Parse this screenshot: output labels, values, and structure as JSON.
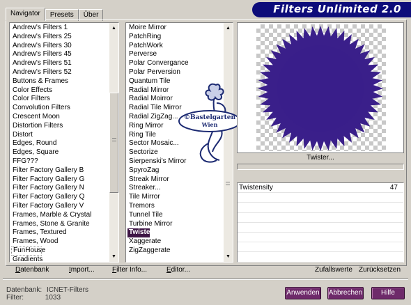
{
  "tabs": [
    {
      "label": "Navigator",
      "active": true
    },
    {
      "label": "Presets"
    },
    {
      "label": "Über"
    }
  ],
  "banner": {
    "title": "Filters Unlimited 2.0"
  },
  "categories": {
    "items": [
      "Andrew's Filters 1",
      "Andrew's Filters 25",
      "Andrew's Filters 30",
      "Andrew's Filters 45",
      "Andrew's Filters 51",
      "Andrew's Filters 52",
      "Buttons & Frames",
      "Color Effects",
      "Color Filters",
      "Convolution Filters",
      "Crescent Moon",
      "Distortion Filters",
      "Distort",
      "Edges, Round",
      "Edges, Square",
      "FFG???",
      "Filter Factory Gallery B",
      "Filter Factory Gallery G",
      "Filter Factory Gallery N",
      "Filter Factory Gallery Q",
      "Filter Factory Gallery V",
      "Frames, Marble & Crystal",
      "Frames, Stone & Granite",
      "Frames, Textured",
      "Frames, Wood",
      "FunHouse",
      "Gradients"
    ],
    "current": "FunHouse"
  },
  "filters": {
    "items": [
      "Moire Mirror",
      "PatchRing",
      "PatchWork",
      "Perverse",
      "Polar Convergance",
      "Polar Perversion",
      "Quantum Tile",
      "Radial Mirror",
      "Radial Moirror",
      "Radial Tile Mirror",
      "Radial ZigZag...",
      "Ring Mirror",
      "Ring Tile",
      "Sector Mosaic...",
      "Sectorize",
      "Sierpenski's Mirror",
      "SpyroZag",
      "Streak Mirror",
      "Streaker...",
      "Tile Mirror",
      "Tremors",
      "Tunnel Tile",
      "Turbine Mirror",
      "Twister",
      "Xaggerate",
      "ZigZaggerate"
    ],
    "selected": "Twister"
  },
  "preview": {
    "filter_name": "Twister...",
    "shape_color": "#3a1f8a"
  },
  "watermark": {
    "line1": "©Bastelgarten",
    "line2": "Wien"
  },
  "params": [
    {
      "label": "Twistensity",
      "value": "47"
    },
    {
      "label": "",
      "value": ""
    },
    {
      "label": "",
      "value": ""
    },
    {
      "label": "",
      "value": ""
    },
    {
      "label": "",
      "value": ""
    },
    {
      "label": "",
      "value": ""
    },
    {
      "label": "",
      "value": ""
    },
    {
      "label": "",
      "value": ""
    }
  ],
  "actions": {
    "datenbank": "Datenbank",
    "import": "Import...",
    "filter_info": "Filter Info...",
    "editor": "Editor...",
    "zufallswerte": "Zufallswerte",
    "zuruecksetzen": "Zurücksetzen"
  },
  "status": {
    "db_label": "Datenbank:",
    "db_value": "ICNET-Filters",
    "filter_label": "Filter:",
    "filter_value": "1033"
  },
  "buttons": {
    "apply": "Anwenden",
    "cancel": "Abbrechen",
    "help": "Hilfe"
  }
}
